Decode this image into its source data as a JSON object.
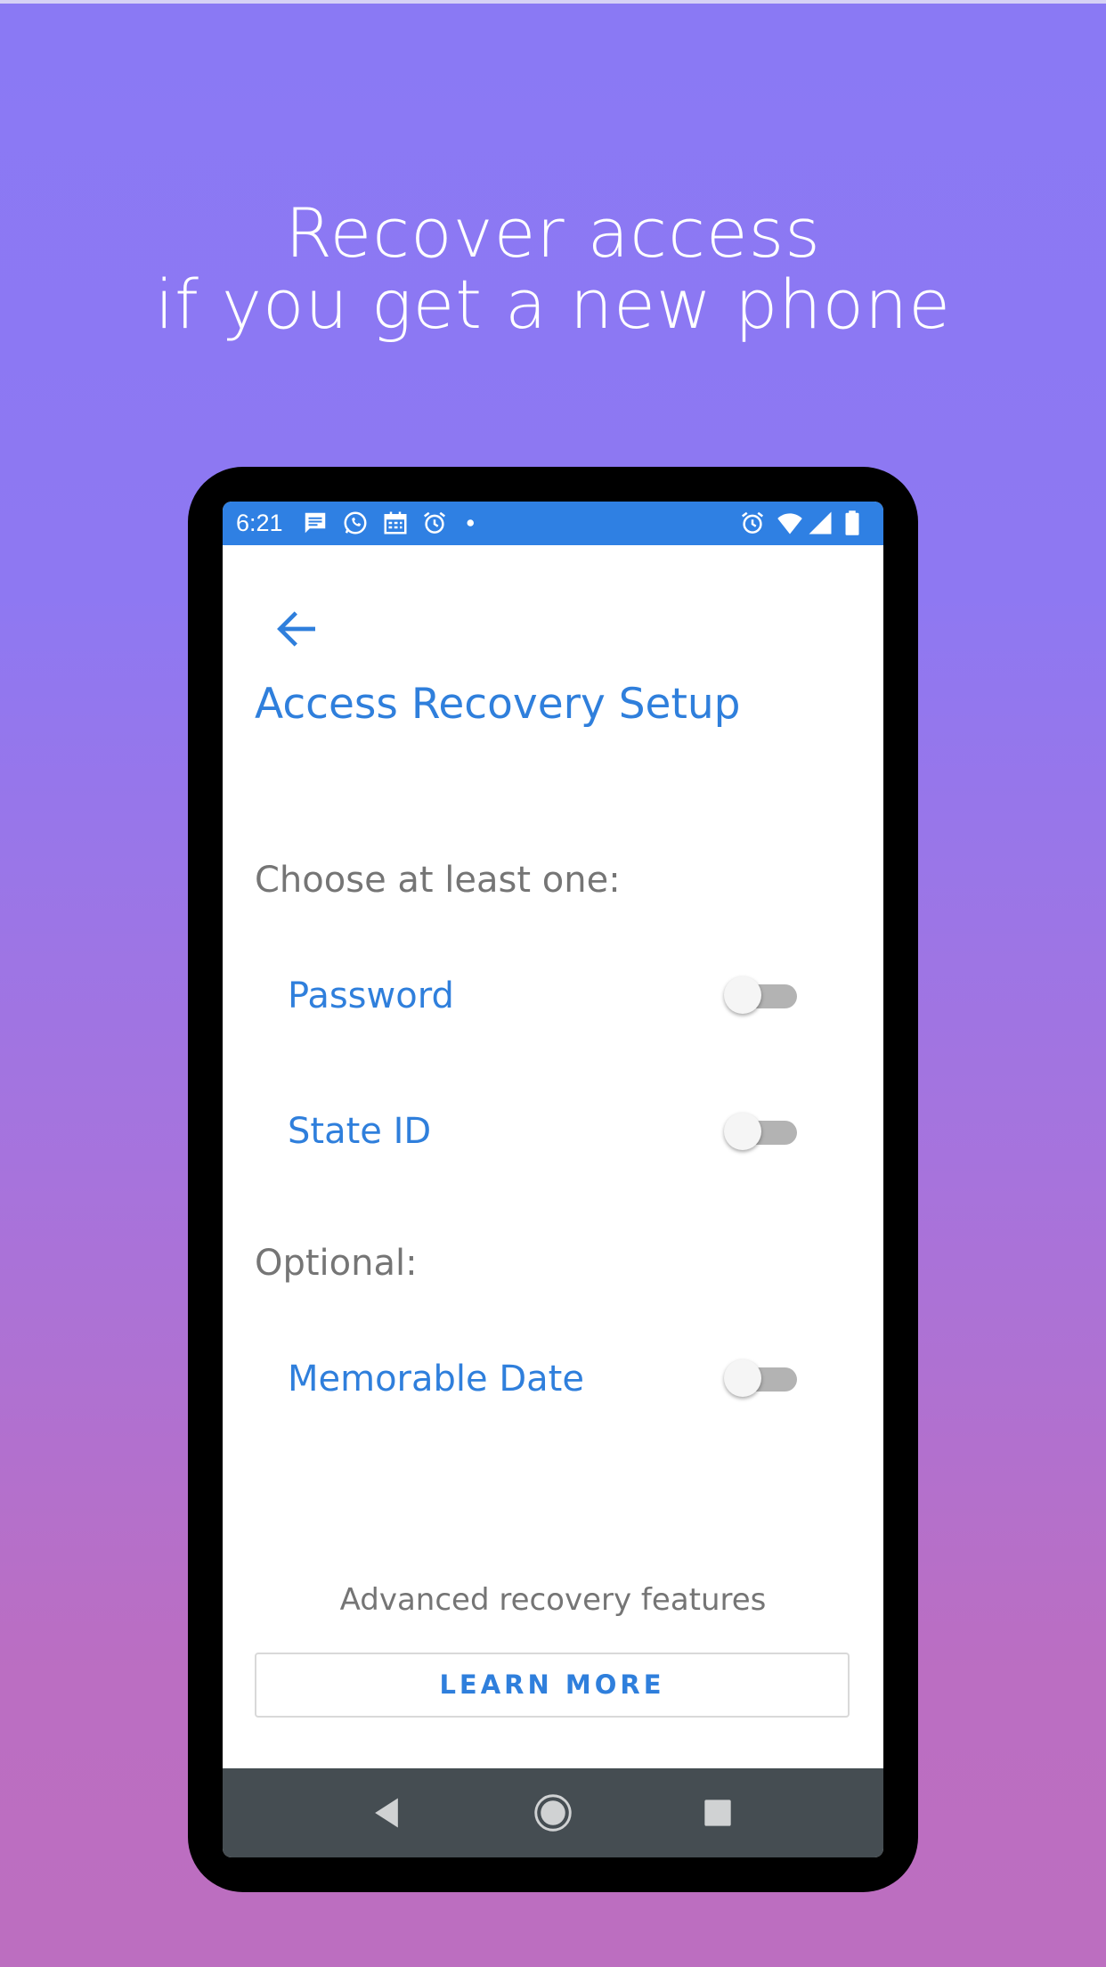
{
  "headline": {
    "line1": "Recover access",
    "line2": "if you get a new phone"
  },
  "status_bar": {
    "time": "6:21",
    "left_icons": [
      "message-icon",
      "whatsapp-icon",
      "calendar-icon",
      "alarm-icon",
      "dot-icon"
    ],
    "right_icons": [
      "alarm-icon",
      "wifi-icon",
      "signal-icon",
      "battery-icon"
    ]
  },
  "screen": {
    "title": "Access Recovery Setup",
    "required_label": "Choose at least one:",
    "optional_label": "Optional:",
    "options": [
      {
        "label": "Password",
        "enabled": false
      },
      {
        "label": "State ID",
        "enabled": false
      },
      {
        "label": "Memorable Date",
        "enabled": false
      }
    ],
    "advanced_text": "Advanced recovery features",
    "learn_more_label": "LEARN MORE"
  },
  "colors": {
    "accent": "#2f7fdc",
    "status_bar": "#2f80e3",
    "nav_bar": "#454d52",
    "secondary_text": "#757575"
  }
}
